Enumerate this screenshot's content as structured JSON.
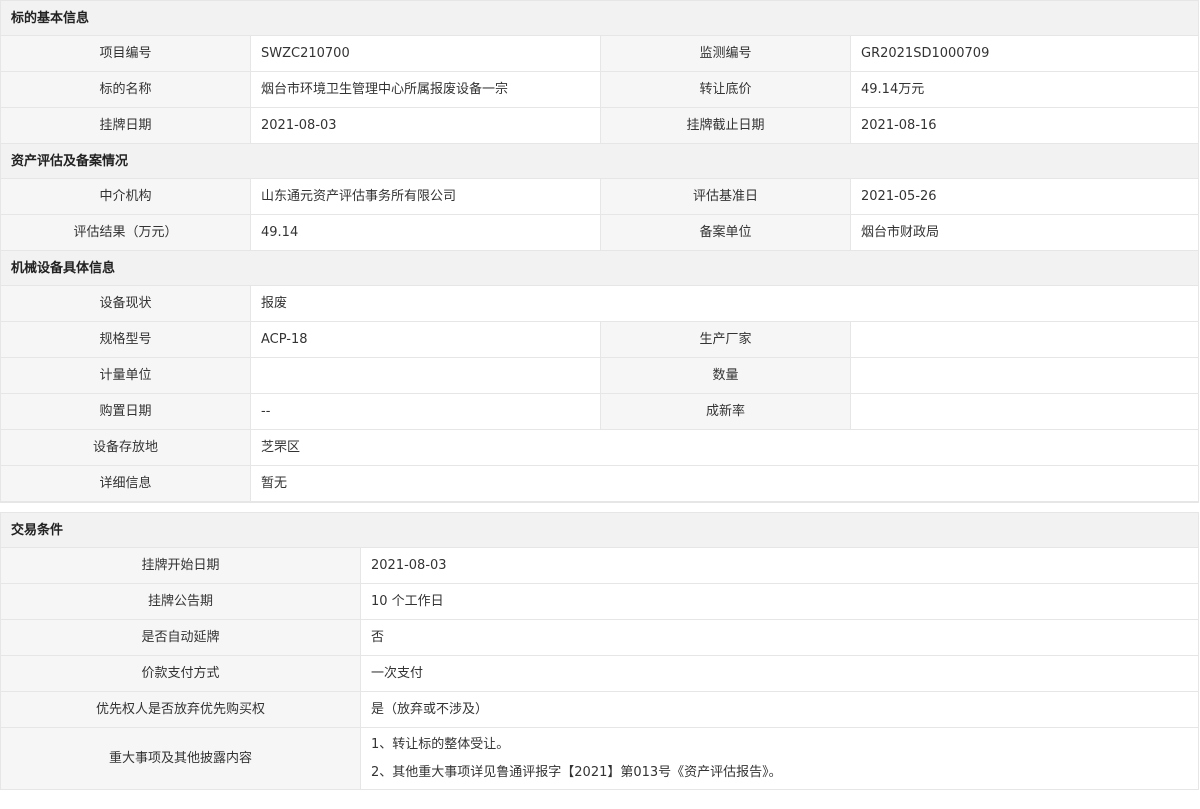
{
  "basic": {
    "title": "标的基本信息",
    "rows": [
      {
        "l1": "项目编号",
        "v1": "SWZC210700",
        "l2": "监测编号",
        "v2": "GR2021SD1000709"
      },
      {
        "l1": "标的名称",
        "v1": "烟台市环境卫生管理中心所属报废设备一宗",
        "l2": "转让底价",
        "v2": "49.14万元"
      },
      {
        "l1": "挂牌日期",
        "v1": "2021-08-03",
        "l2": "挂牌截止日期",
        "v2": "2021-08-16"
      }
    ]
  },
  "assessment": {
    "title": "资产评估及备案情况",
    "rows": [
      {
        "l1": "中介机构",
        "v1": "山东通元资产评估事务所有限公司",
        "l2": "评估基准日",
        "v2": "2021-05-26"
      },
      {
        "l1": "评估结果（万元）",
        "v1": "49.14",
        "l2": "备案单位",
        "v2": "烟台市财政局"
      }
    ]
  },
  "equipment": {
    "title": "机械设备具体信息",
    "status_label": "设备现状",
    "status_value": "报废",
    "rows": [
      {
        "l1": "规格型号",
        "v1": "ACP-18",
        "l2": "生产厂家",
        "v2": ""
      },
      {
        "l1": "计量单位",
        "v1": "",
        "l2": "数量",
        "v2": ""
      },
      {
        "l1": "购置日期",
        "v1": "--",
        "l2": "成新率",
        "v2": ""
      }
    ],
    "location_label": "设备存放地",
    "location_value": "芝罘区",
    "detail_label": "详细信息",
    "detail_value": "暂无"
  },
  "trade": {
    "title": "交易条件",
    "rows": [
      {
        "label": "挂牌开始日期",
        "value": "2021-08-03"
      },
      {
        "label": "挂牌公告期",
        "value": "10 个工作日"
      },
      {
        "label": "是否自动延牌",
        "value": "否"
      },
      {
        "label": "价款支付方式",
        "value": "一次支付"
      },
      {
        "label": "优先权人是否放弃优先购买权",
        "value": "是（放弃或不涉及）"
      }
    ],
    "disclosure_label": "重大事项及其他披露内容",
    "disclosure_lines": [
      "1、转让标的整体受让。",
      "2、其他重大事项详见鲁通评报字【2021】第013号《资产评估报告》。"
    ]
  }
}
